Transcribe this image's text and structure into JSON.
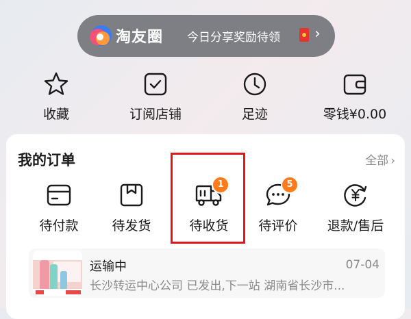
{
  "banner": {
    "brand_name": "淘友圈",
    "promo_text": "今日分享奖励待领",
    "icons": [
      "taoyouquan-logo",
      "red-packet-icon",
      "chevron-right-icon"
    ]
  },
  "quick_links": [
    {
      "label": "收藏",
      "icon": "star-icon"
    },
    {
      "label": "订阅店铺",
      "icon": "checkbox-icon"
    },
    {
      "label": "足迹",
      "icon": "clock-icon"
    },
    {
      "label": "零钱¥0.00",
      "icon": "wallet-icon"
    }
  ],
  "orders": {
    "title": "我的订单",
    "all_label": "全部",
    "items": [
      {
        "label": "待付款",
        "icon": "card-icon",
        "badge": ""
      },
      {
        "label": "待发货",
        "icon": "box-icon",
        "badge": ""
      },
      {
        "label": "待收货",
        "icon": "truck-icon",
        "badge": "1"
      },
      {
        "label": "待评价",
        "icon": "comment-icon",
        "badge": "5"
      },
      {
        "label": "退款/售后",
        "icon": "refund-icon",
        "badge": ""
      }
    ],
    "shipment": {
      "status": "运输中",
      "date": "07-04",
      "detail": "长沙转运中心公司 已发出,下一站 湖南省长沙市..."
    }
  },
  "colors": {
    "banner_bg": "#7d7f84",
    "badge": "#ff7a1a",
    "highlight": "#e3161b",
    "muted_text": "#8a8a8a"
  }
}
